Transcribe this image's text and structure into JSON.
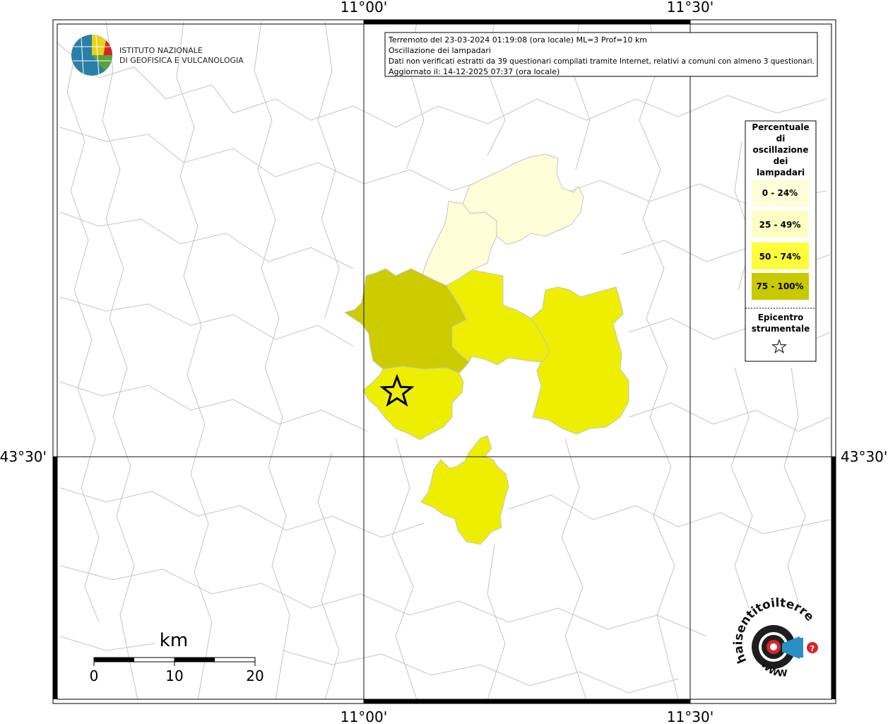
{
  "map": {
    "lon_labels": [
      "11°00'",
      "11°30'"
    ],
    "lat_labels": [
      "43°30'"
    ]
  },
  "info": {
    "lines": [
      "Terremoto del 23-03-2024 01:19:08 (ora locale) ML=3 Prof=10 km",
      "Oscillazione dei lampadari",
      "Dati non verificati estratti da 39 questionari compilati tramite Internet, relativi a comuni con almeno 3 questionari.",
      "Aggiornato il: 14-12-2025 07:37 (ora locale)"
    ]
  },
  "logo": {
    "line1": "ISTITUTO NAZIONALE",
    "line2": "DI GEOFISICA E VULCANOLOGIA"
  },
  "legend": {
    "title_lines": [
      "Percentuale",
      "di",
      "oscillazione",
      "dei",
      "lampadari"
    ],
    "classes": [
      {
        "label": "0 - 24%",
        "color": "#fdfde0"
      },
      {
        "label": "25 - 49%",
        "color": "#fdfdbe"
      },
      {
        "label": "50 - 74%",
        "color": "#fdfd3c"
      },
      {
        "label": "75 - 100%",
        "color": "#c9c900"
      }
    ],
    "epicenter_lines": [
      "Epicentro",
      "strumentale"
    ]
  },
  "scale": {
    "unit": "km",
    "ticks": [
      "0",
      "10",
      "20"
    ]
  },
  "colors": {
    "class_0_24": "#fefed8",
    "class_25_49": "#fefec2",
    "class_50_74": "#eeee00",
    "class_75_100": "#cccc00",
    "comune_border": "#c4c4c4"
  },
  "badge": {
    "text": "haisentitoilterremoto.it",
    "www": "WWW"
  }
}
